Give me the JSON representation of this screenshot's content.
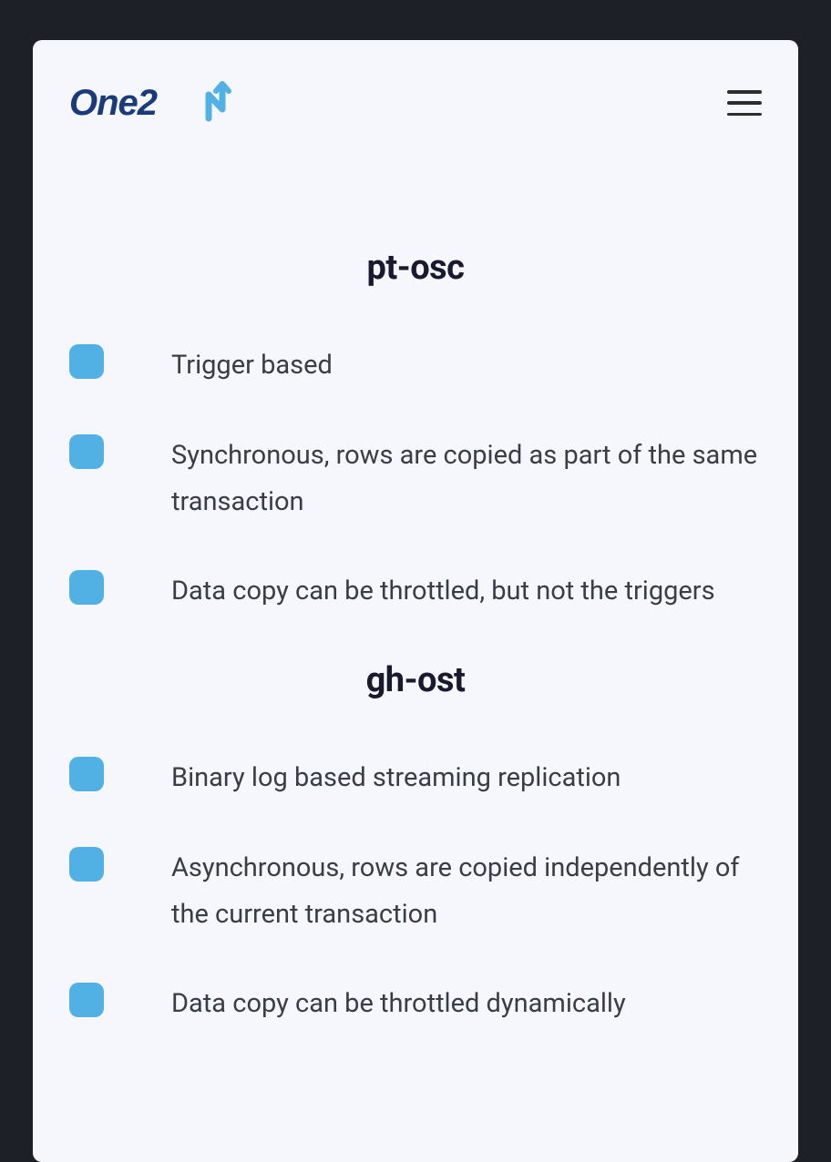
{
  "brand": {
    "name": "One2N"
  },
  "sections": [
    {
      "title": "pt-osc",
      "items": [
        "Trigger based",
        "Synchronous, rows are copied as part of the same transaction",
        "Data copy can be throttled, but not the triggers"
      ]
    },
    {
      "title": "gh-ost",
      "items": [
        "Binary log based streaming replication",
        "Asynchronous, rows are copied independently of the current transaction",
        "Data copy can be throttled dynamically"
      ]
    }
  ]
}
